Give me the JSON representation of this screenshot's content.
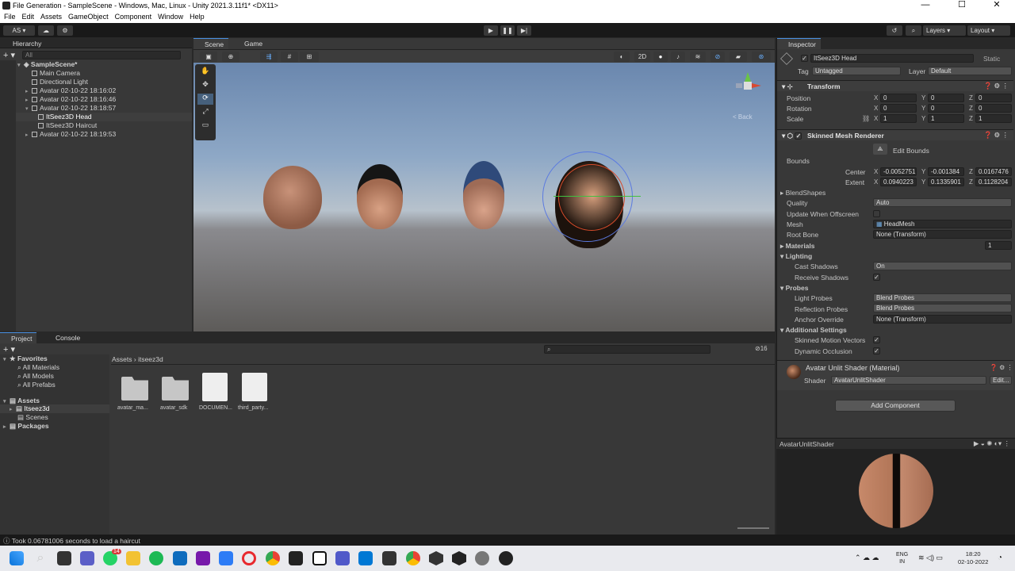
{
  "window": {
    "title": "File Generation - SampleScene - Windows, Mac, Linux - Unity 2021.3.11f1* <DX11>",
    "controls": [
      "—",
      "☐",
      "✕"
    ]
  },
  "menu": [
    "File",
    "Edit",
    "Assets",
    "GameObject",
    "Component",
    "Window",
    "Help"
  ],
  "toolbar": {
    "account": "AS",
    "layers": "Layers",
    "layout": "Layout"
  },
  "hierarchy": {
    "title": "Hierarchy",
    "search_placeholder": "All",
    "scene": "SampleScene*",
    "items": [
      "Main Camera",
      "Directional Light",
      "Avatar 02-10-22 18:16:02",
      "Avatar 02-10-22 18:16:46",
      "Avatar 02-10-22 18:18:57",
      "ItSeez3D Head",
      "ItSeez3D Haircut",
      "Avatar 02-10-22 18:19:53"
    ]
  },
  "scene_view": {
    "tabs": [
      "Scene",
      "Game"
    ],
    "toggle_2d": "2D",
    "back_label": "< Back"
  },
  "project": {
    "tabs": [
      "Project",
      "Console"
    ],
    "favorites_label": "Favorites",
    "favorites": [
      "All Materials",
      "All Models",
      "All Prefabs"
    ],
    "assets_label": "Assets",
    "asset_tree": [
      "Itseez3d",
      "Scenes"
    ],
    "packages_label": "Packages",
    "breadcrumb": [
      "Assets",
      "itseez3d"
    ],
    "files": [
      "avatar_ma...",
      "avatar_sdk",
      "DOCUMEN...",
      "third_party..."
    ],
    "count": "16"
  },
  "status": "Took 0.06781006 seconds to load a haircut",
  "inspector": {
    "tab": "Inspector",
    "object_name": "ItSeez3D Head",
    "static_label": "Static",
    "tag_label": "Tag",
    "tag_value": "Untagged",
    "layer_label": "Layer",
    "layer_value": "Default",
    "transform": {
      "title": "Transform",
      "position": {
        "label": "Position",
        "x": "0",
        "y": "0",
        "z": "0"
      },
      "rotation": {
        "label": "Rotation",
        "x": "0",
        "y": "0",
        "z": "0"
      },
      "scale": {
        "label": "Scale",
        "x": "1",
        "y": "1",
        "z": "1"
      }
    },
    "smr": {
      "title": "Skinned Mesh Renderer",
      "edit_bounds": "Edit Bounds",
      "bounds_label": "Bounds",
      "center_label": "Center",
      "center": {
        "x": "-0.0052751",
        "y": "-0.001384",
        "z": "0.0167476"
      },
      "extent_label": "Extent",
      "extent": {
        "x": "0.0940223",
        "y": "0.1335901",
        "z": "0.1128204"
      },
      "blendshapes": "BlendShapes",
      "quality_label": "Quality",
      "quality": "Auto",
      "update_offscreen": "Update When Offscreen",
      "mesh_label": "Mesh",
      "mesh": "HeadMesh",
      "root_bone_label": "Root Bone",
      "root_bone": "None (Transform)",
      "materials": "Materials",
      "materials_count": "1",
      "lighting": "Lighting",
      "cast_shadows_label": "Cast Shadows",
      "cast_shadows": "On",
      "receive_shadows": "Receive Shadows",
      "probes": "Probes",
      "light_probes_label": "Light Probes",
      "light_probes": "Blend Probes",
      "reflection_probes_label": "Reflection Probes",
      "reflection_probes": "Blend Probes",
      "anchor_override_label": "Anchor Override",
      "anchor_override": "None (Transform)",
      "additional": "Additional Settings",
      "skinned_motion": "Skinned Motion Vectors",
      "dynamic_occlusion": "Dynamic Occlusion"
    },
    "material": {
      "name": "Avatar Unlit Shader (Material)",
      "shader_label": "Shader",
      "shader": "AvatarUnlitShader",
      "edit": "Edit..."
    },
    "add_component": "Add Component",
    "preview_title": "AvatarUnlitShader"
  },
  "taskbar": {
    "lang": "ENG",
    "lang2": "IN",
    "time": "18:20",
    "date": "02-10-2022",
    "whatsapp_badge": "14"
  }
}
